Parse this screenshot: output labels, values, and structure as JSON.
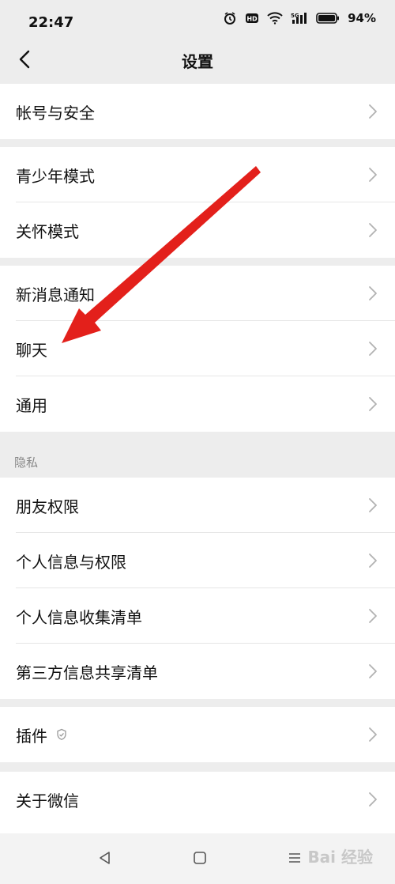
{
  "status": {
    "time": "22:47",
    "battery": "94%"
  },
  "nav": {
    "title": "设置"
  },
  "groups": [
    {
      "items": [
        {
          "label": "帐号与安全"
        }
      ]
    },
    {
      "items": [
        {
          "label": "青少年模式"
        },
        {
          "label": "关怀模式"
        }
      ]
    },
    {
      "items": [
        {
          "label": "新消息通知"
        },
        {
          "label": "聊天"
        },
        {
          "label": "通用"
        }
      ]
    },
    {
      "section": "隐私",
      "items": [
        {
          "label": "朋友权限"
        },
        {
          "label": "个人信息与权限"
        },
        {
          "label": "个人信息收集清单"
        },
        {
          "label": "第三方信息共享清单"
        }
      ]
    },
    {
      "items": [
        {
          "label": "插件"
        }
      ]
    },
    {
      "items": [
        {
          "label": "关于微信"
        }
      ]
    }
  ],
  "watermark": "Bai 经验",
  "annotation": {
    "color": "#e3201b"
  },
  "icons": {
    "back": "chevron-left-icon",
    "chevron": "chevron-right-icon",
    "plugin": "plugin-icon",
    "nav_back": "triangle-back-icon",
    "nav_home": "square-home-icon",
    "nav_menu": "menu-icon"
  }
}
